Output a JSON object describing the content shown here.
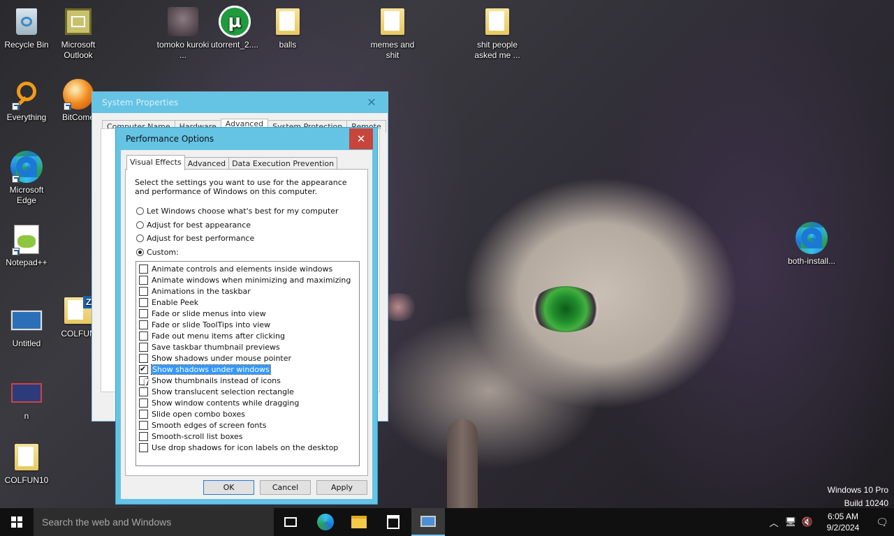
{
  "desktop": {
    "icons": [
      {
        "label": "Recycle Bin"
      },
      {
        "label": "Microsoft Outlook"
      },
      {
        "label": "tomoko kuroki ..."
      },
      {
        "label": "utorrent_2...."
      },
      {
        "label": "balls"
      },
      {
        "label": "memes and shit"
      },
      {
        "label": "shit people asked me ..."
      },
      {
        "label": "Everything"
      },
      {
        "label": "BitCome"
      },
      {
        "label": "Microsoft Edge"
      },
      {
        "label": "Notepad++"
      },
      {
        "label": "Untitled"
      },
      {
        "label": "COLFUN"
      },
      {
        "label": "n"
      },
      {
        "label": "COLFUN10"
      },
      {
        "label": "both-install..."
      }
    ]
  },
  "system_properties": {
    "title": "System Properties",
    "tabs": [
      "Computer Name",
      "Hardware",
      "Advanced",
      "System Protection",
      "Remote"
    ],
    "active_tab": "Advanced"
  },
  "performance_options": {
    "title": "Performance Options",
    "tabs": [
      "Visual Effects",
      "Advanced",
      "Data Execution Prevention"
    ],
    "active_tab": "Visual Effects",
    "description": "Select the settings you want to use for the appearance and performance of Windows on this computer.",
    "radio_options": [
      {
        "label": "Let Windows choose what's best for my computer",
        "selected": false
      },
      {
        "label": "Adjust for best appearance",
        "selected": false
      },
      {
        "label": "Adjust for best performance",
        "selected": false
      },
      {
        "label": "Custom:",
        "selected": true
      }
    ],
    "effects": [
      {
        "label": "Animate controls and elements inside windows",
        "checked": false
      },
      {
        "label": "Animate windows when minimizing and maximizing",
        "checked": false
      },
      {
        "label": "Animations in the taskbar",
        "checked": false
      },
      {
        "label": "Enable Peek",
        "checked": false
      },
      {
        "label": "Fade or slide menus into view",
        "checked": false
      },
      {
        "label": "Fade or slide ToolTips into view",
        "checked": false
      },
      {
        "label": "Fade out menu items after clicking",
        "checked": false
      },
      {
        "label": "Save taskbar thumbnail previews",
        "checked": false
      },
      {
        "label": "Show shadows under mouse pointer",
        "checked": false
      },
      {
        "label": "Show shadows under windows",
        "checked": true,
        "selected": true
      },
      {
        "label": "Show thumbnails instead of icons",
        "checked": false
      },
      {
        "label": "Show translucent selection rectangle",
        "checked": false
      },
      {
        "label": "Show window contents while dragging",
        "checked": false
      },
      {
        "label": "Slide open combo boxes",
        "checked": false
      },
      {
        "label": "Smooth edges of screen fonts",
        "checked": false
      },
      {
        "label": "Smooth-scroll list boxes",
        "checked": false
      },
      {
        "label": "Use drop shadows for icon labels on the desktop",
        "checked": false
      }
    ],
    "buttons": {
      "ok": "OK",
      "cancel": "Cancel",
      "apply": "Apply"
    }
  },
  "watermark": {
    "line1": "Windows 10 Pro",
    "line2": "Build 10240"
  },
  "taskbar": {
    "search_placeholder": "Search the web and Windows",
    "clock_time": "6:05 AM",
    "clock_date": "9/2/2024"
  },
  "colors": {
    "accent": "#65c3e4",
    "close": "#c7453b",
    "selection": "#3399ff"
  }
}
